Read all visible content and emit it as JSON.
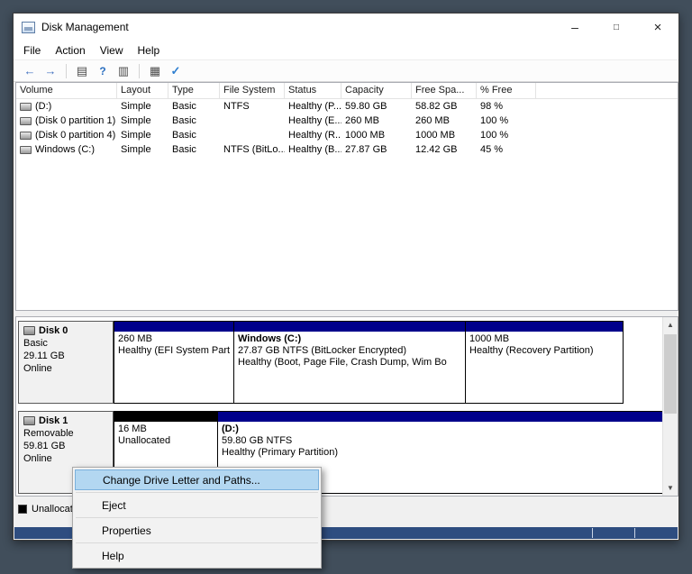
{
  "colors": {
    "desktop_bg": "#414e5b",
    "partition_band_primary": "#00008b",
    "unallocated_band": "#000000",
    "menu_highlight": "#b3d7f1",
    "bottom_strip": "#2e4d80"
  },
  "window": {
    "title": "Disk Management",
    "caption_buttons": {
      "minimize": "–",
      "maximize": "□",
      "close": "×"
    },
    "menu_bar": [
      "File",
      "Action",
      "View",
      "Help"
    ],
    "toolbar": {
      "back": "←",
      "forward": "→",
      "console_tree": "▤",
      "help": "?",
      "views": "▥",
      "panel": "▦",
      "check": "✓"
    }
  },
  "volume_list": {
    "columns": [
      "Volume",
      "Layout",
      "Type",
      "File System",
      "Status",
      "Capacity",
      "Free Spa...",
      "% Free"
    ],
    "rows": [
      {
        "volume": "(D:)",
        "layout": "Simple",
        "type": "Basic",
        "file_system": "NTFS",
        "status": "Healthy (P...",
        "capacity": "59.80 GB",
        "free_space": "58.82 GB",
        "pct_free": "98 %"
      },
      {
        "volume": "(Disk 0 partition 1)",
        "layout": "Simple",
        "type": "Basic",
        "file_system": "",
        "status": "Healthy (E...",
        "capacity": "260 MB",
        "free_space": "260 MB",
        "pct_free": "100 %"
      },
      {
        "volume": "(Disk 0 partition 4)",
        "layout": "Simple",
        "type": "Basic",
        "file_system": "",
        "status": "Healthy (R...",
        "capacity": "1000 MB",
        "free_space": "1000 MB",
        "pct_free": "100 %"
      },
      {
        "volume": "Windows (C:)",
        "layout": "Simple",
        "type": "Basic",
        "file_system": "NTFS (BitLo...",
        "status": "Healthy (B...",
        "capacity": "27.87 GB",
        "free_space": "12.42 GB",
        "pct_free": "45 %"
      }
    ]
  },
  "graphical_view": {
    "disks": [
      {
        "name": "Disk 0",
        "type": "Basic",
        "size": "29.11 GB",
        "status": "Online",
        "partitions": [
          {
            "lines": [
              "260 MB",
              "Healthy (EFI System Part"
            ]
          },
          {
            "lines": [
              "Windows (C:)",
              "27.87 GB NTFS (BitLocker Encrypted)",
              "Healthy (Boot, Page File, Crash Dump, Wim Bo"
            ]
          },
          {
            "lines": [
              "1000 MB",
              "Healthy (Recovery Partition)"
            ]
          }
        ]
      },
      {
        "name": "Disk 1",
        "type": "Removable",
        "size": "59.81 GB",
        "status": "Online",
        "partitions": [
          {
            "lines": [
              "16 MB",
              "Unallocated"
            ]
          },
          {
            "lines": [
              "(D:)",
              "59.80 GB NTFS",
              "Healthy (Primary Partition)"
            ]
          }
        ]
      }
    ]
  },
  "legend": {
    "items": [
      {
        "label": "Unallocated",
        "swatch": "#000000"
      }
    ]
  },
  "context_menu": {
    "items": [
      "Change Drive Letter and Paths...",
      "Eject",
      "Properties",
      "Help"
    ],
    "highlighted": "Change Drive Letter and Paths..."
  },
  "scrollbar": {
    "up": "▲",
    "down": "▼"
  }
}
